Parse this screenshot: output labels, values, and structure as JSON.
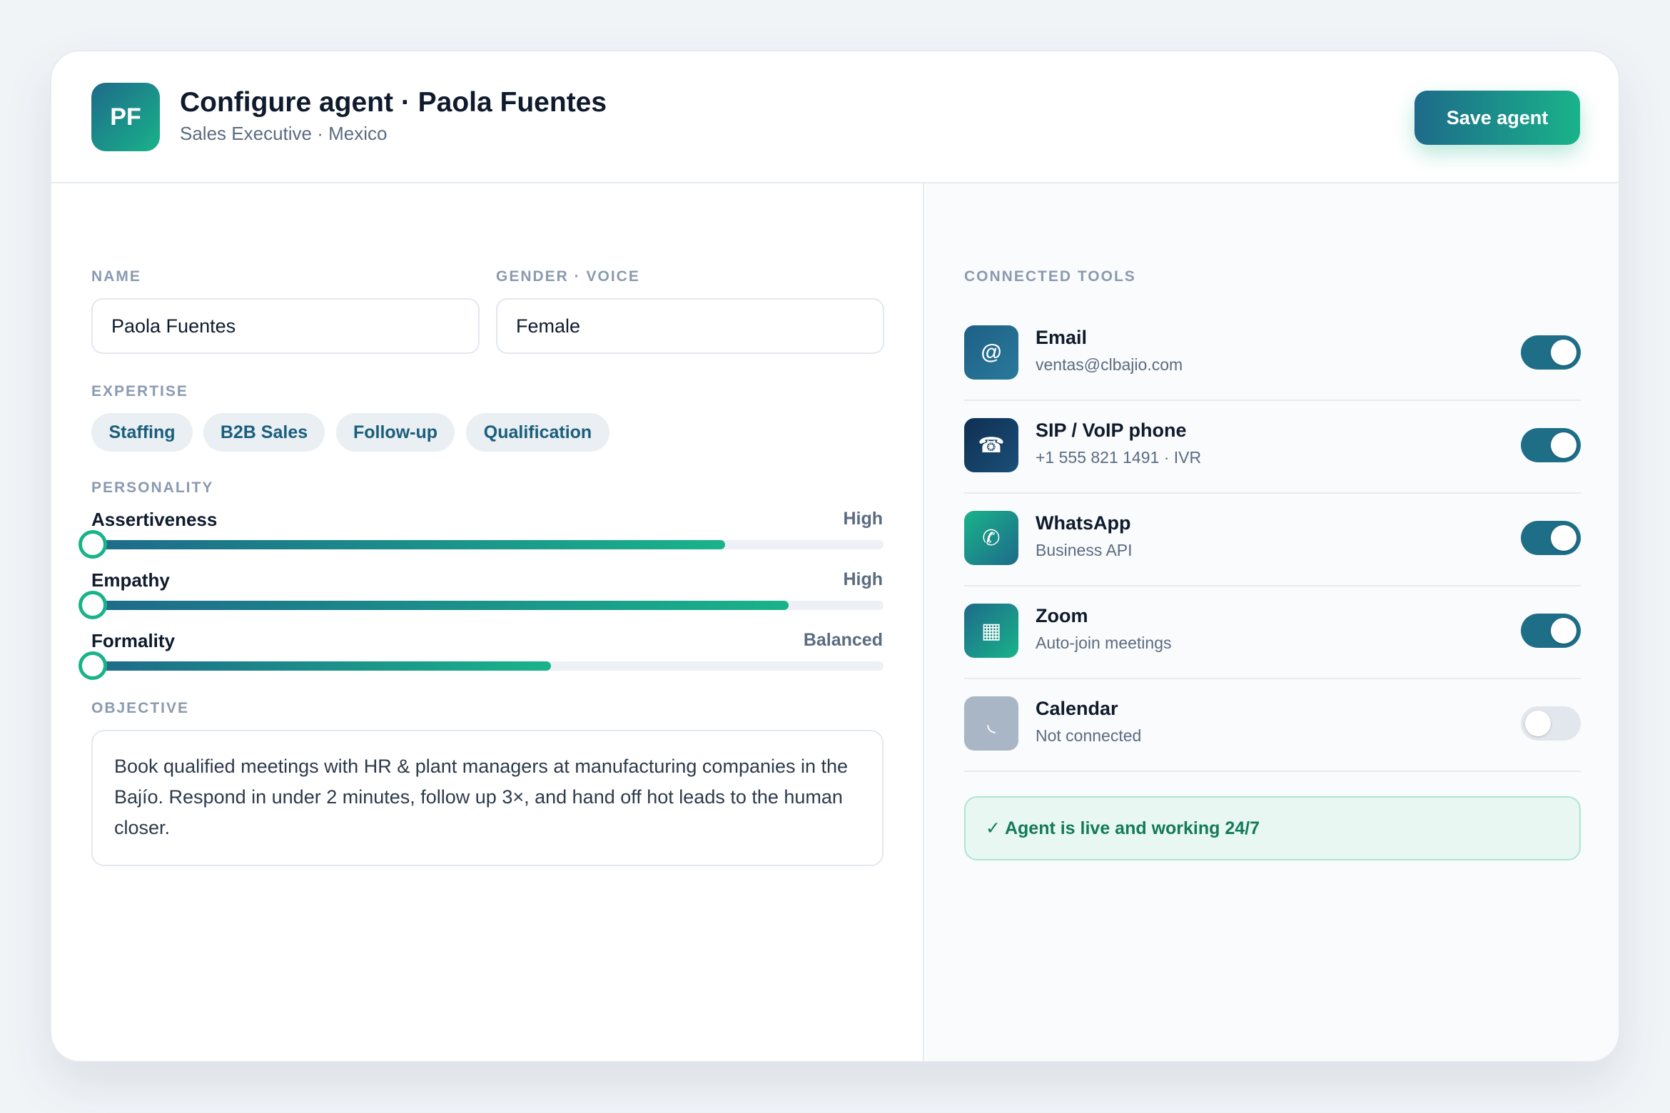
{
  "header": {
    "avatar_initials": "PF",
    "title": "Configure agent · Paola Fuentes",
    "subtitle": "Sales Executive · Mexico",
    "save_label": "Save agent"
  },
  "form": {
    "name_label": "NAME",
    "name_value": "Paola Fuentes",
    "gender_label": "GENDER · VOICE",
    "gender_value": "Female",
    "expertise_label": "EXPERTISE",
    "expertise": [
      "Staffing",
      "B2B Sales",
      "Follow-up",
      "Qualification"
    ],
    "personality_label": "PERSONALITY",
    "personality": [
      {
        "name": "Assertiveness",
        "value": "High",
        "level": 0.8
      },
      {
        "name": "Empathy",
        "value": "High",
        "level": 0.88
      },
      {
        "name": "Formality",
        "value": "Balanced",
        "level": 0.58
      }
    ],
    "objective_label": "OBJECTIVE",
    "objective_text": "Book qualified meetings with HR & plant managers at manufacturing companies in the Bajío. Respond in under 2 minutes, follow up 3×, and hand off hot leads to the human closer."
  },
  "tools": {
    "label": "CONNECTED TOOLS",
    "items": [
      {
        "name": "Email",
        "detail": "ventas@clbajio.com",
        "icon": "at-icon",
        "glyph": "@",
        "enabled": true
      },
      {
        "name": "SIP / VoIP phone",
        "detail": "+1 555 821 1491 · IVR",
        "icon": "phone-icon",
        "glyph": "☎",
        "enabled": true
      },
      {
        "name": "WhatsApp",
        "detail": "Business API",
        "icon": "whatsapp-icon",
        "glyph": "✆",
        "enabled": true
      },
      {
        "name": "Zoom",
        "detail": "Auto-join meetings",
        "icon": "zoom-icon",
        "glyph": "▦",
        "enabled": true
      },
      {
        "name": "Calendar",
        "detail": "Not connected",
        "icon": "calendar-icon",
        "glyph": "◟",
        "enabled": false
      }
    ],
    "status_text": "✓ Agent is live and working 24/7"
  },
  "colors": {
    "accent_start": "#1e6a8a",
    "accent_end": "#19b38a",
    "status_green": "#137a5a"
  }
}
